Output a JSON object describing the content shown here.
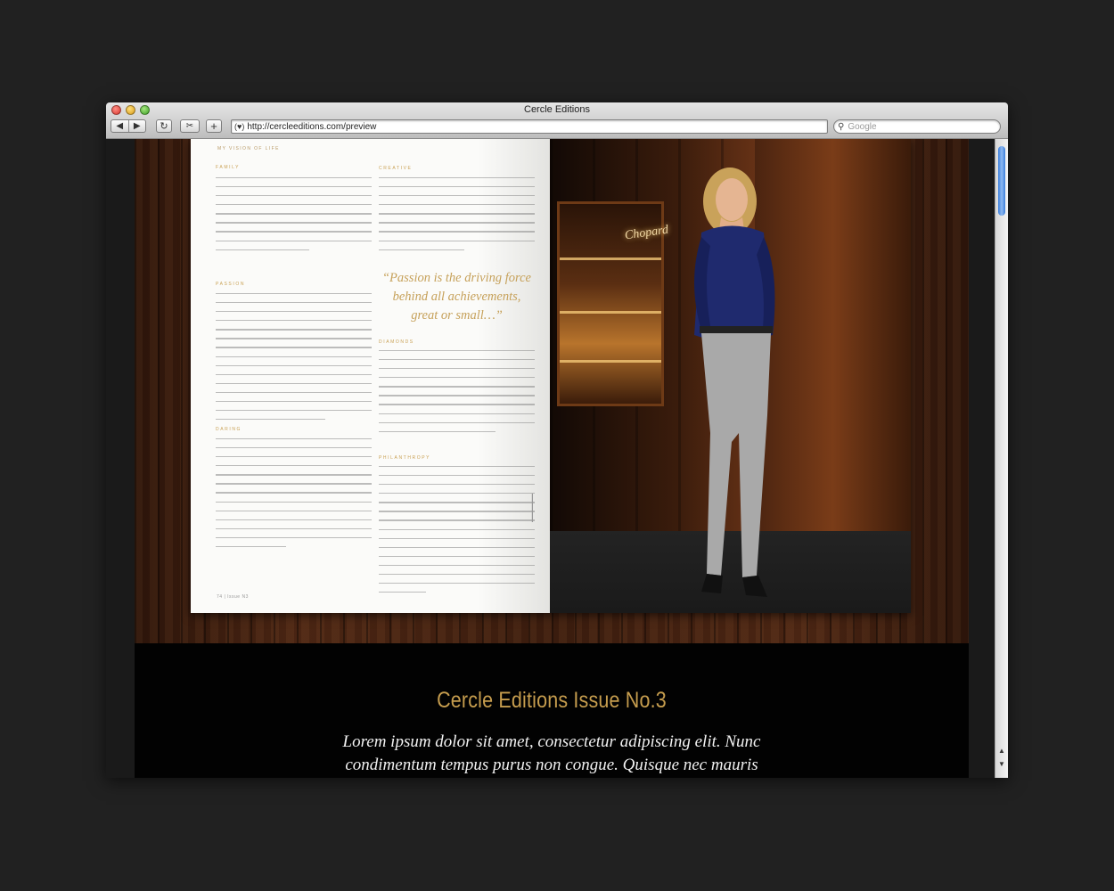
{
  "window": {
    "title": "Cercle Editions"
  },
  "toolbar": {
    "back_icon": "◀",
    "forward_icon": "▶",
    "reload_icon": "↻",
    "snapshot_icon": "✂",
    "add_icon": "+",
    "url": "http://cercleeditions.com/preview",
    "search_placeholder": "Google"
  },
  "magazine": {
    "running_head": "MY VISION OF LIFE",
    "sections": {
      "family": "FAMILY",
      "passion": "PASSION",
      "daring": "DARING",
      "creative": "CREATIVE",
      "diamonds": "DIAMONDS",
      "philanthropy": "PHILANTHROPY"
    },
    "pull_quote": "“Passion is the driving force behind all achievements, great or small…”",
    "folio": "74 | Issue N3",
    "brand_sign": "Chopard"
  },
  "hero": {
    "title": "Cercle Editions Issue No.3",
    "body": "Lorem ipsum dolor sit amet, consectetur adipiscing elit. Nunc condimentum tempus purus non congue. Quisque nec mauris"
  }
}
